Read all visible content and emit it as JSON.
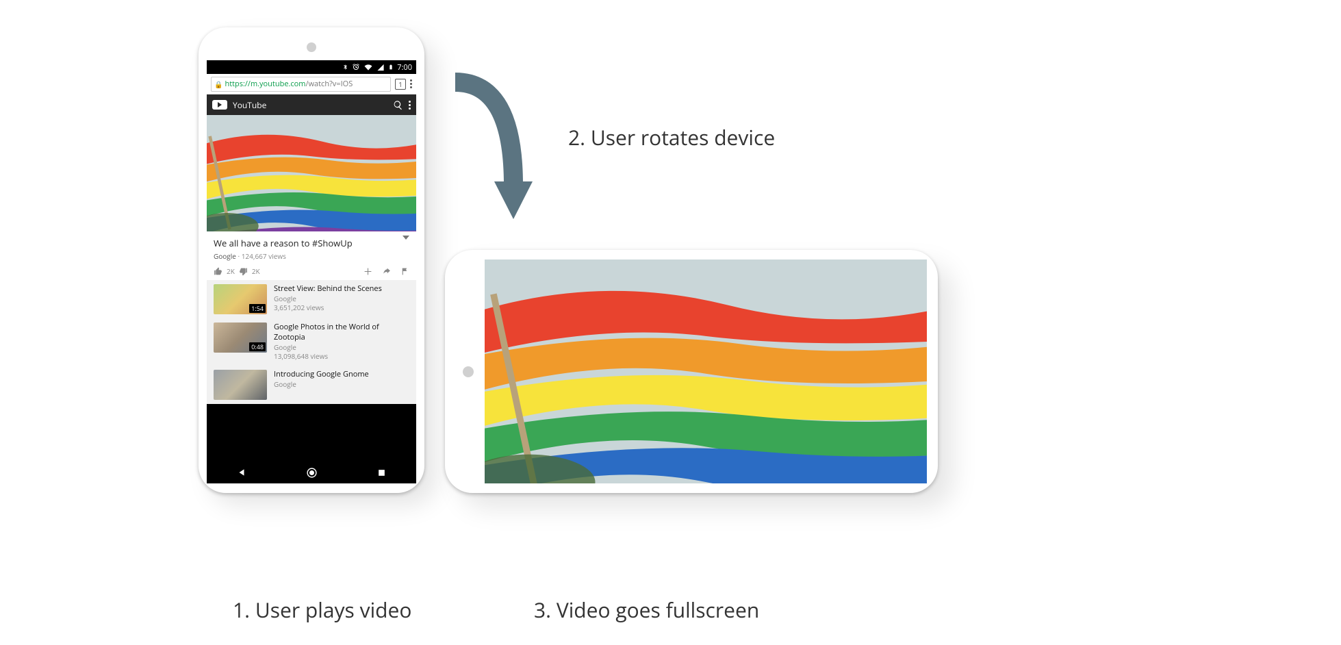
{
  "captions": {
    "step1": "1. User plays video",
    "step2": "2. User rotates device",
    "step3": "3. Video goes fullscreen"
  },
  "status": {
    "time": "7:00"
  },
  "omnibox": {
    "host": "https://m.youtube.com",
    "path": "/watch?v=IOS",
    "tab_count": "1"
  },
  "youtube_header": {
    "label": "YouTube"
  },
  "video": {
    "title": "We all have a reason to #ShowUp",
    "channel": "Google",
    "views_sep": " · ",
    "views": "124,667 views",
    "likes": "2K",
    "dislikes": "2K"
  },
  "suggestions": [
    {
      "title": "Street View: Behind the Scenes",
      "channel": "Google",
      "views": "3,651,202 views",
      "duration": "1:54",
      "thumb_colors": [
        "#b7d37c",
        "#e6c96f",
        "#cc8f5a"
      ]
    },
    {
      "title": "Google Photos in the World of Zootopia",
      "channel": "Google",
      "views": "13,098,648 views",
      "duration": "0:48",
      "thumb_colors": [
        "#cbb79a",
        "#9b8a74",
        "#6e7a88"
      ]
    },
    {
      "title": "Introducing Google Gnome",
      "channel": "Google",
      "views": "",
      "duration": "",
      "thumb_colors": [
        "#9aa0a6",
        "#c0b8a0",
        "#5f6368"
      ]
    }
  ],
  "colors": {
    "arrow": "#5b7481",
    "flag_stripes": [
      "#e8432e",
      "#f09a2b",
      "#f7e33b",
      "#3aa655",
      "#2b6cc4",
      "#7b3fa0"
    ],
    "flag_sky": "#c9d6d8"
  }
}
